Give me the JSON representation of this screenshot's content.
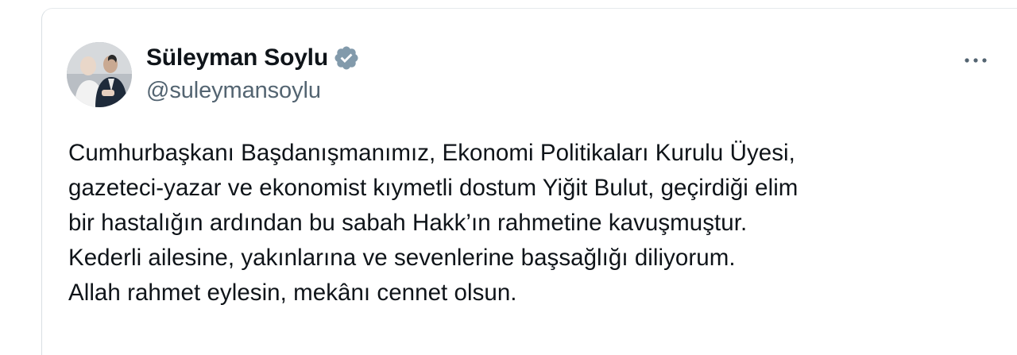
{
  "author": {
    "display_name": "Süleyman Soylu",
    "handle": "@suleymansoylu",
    "verified": true
  },
  "icons": {
    "avatar": "profile-photo",
    "verified": "verified-badge-icon",
    "more": "more-options-icon"
  },
  "colors": {
    "text": "#0f1419",
    "secondary": "#536471",
    "badge": "#829aab"
  },
  "tweet": {
    "lines": [
      "Cumhurbaşkanı Başdanışmanımız, Ekonomi Politikaları Kurulu Üyesi,",
      "gazeteci-yazar ve ekonomist kıymetli dostum Yiğit Bulut, geçirdiği elim",
      "bir hastalığın ardından bu sabah Hakk’ın rahmetine kavuşmuştur.",
      "Kederli ailesine, yakınlarına ve sevenlerine başsağlığı diliyorum.",
      "Allah rahmet eylesin, mekânı cennet olsun."
    ]
  }
}
